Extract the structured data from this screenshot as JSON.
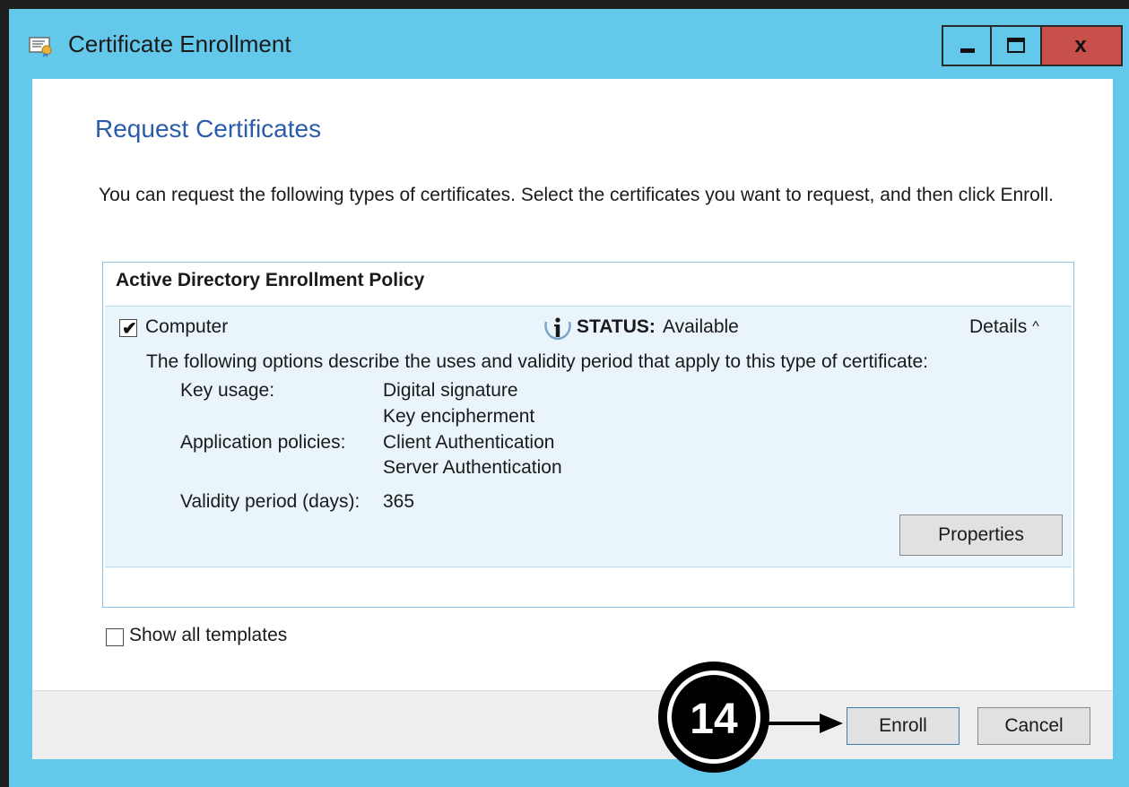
{
  "window": {
    "title": "Certificate Enrollment",
    "controls": {
      "minimize": "minimize",
      "maximize": "maximize",
      "close": "x"
    },
    "colors": {
      "titlebar": "#64c8eb",
      "close_button": "#c7504b",
      "heading": "#2a5cab"
    }
  },
  "page": {
    "heading": "Request Certificates",
    "intro": "You can request the following types of certificates. Select the certificates you want to request, and then click Enroll."
  },
  "policy": {
    "header": "Active Directory Enrollment Policy",
    "item": {
      "name": "Computer",
      "checked": true,
      "status_label": "STATUS:",
      "status_value": "Available",
      "details_label": "Details",
      "description": "The following options describe the uses and validity period that apply to this type of certificate:",
      "properties": {
        "key_usage_label": "Key usage:",
        "key_usage_values": [
          "Digital signature",
          "Key encipherment"
        ],
        "app_policies_label": "Application policies:",
        "app_policies_values": [
          "Client Authentication",
          "Server Authentication"
        ],
        "validity_label": "Validity period (days):",
        "validity_value": "365"
      },
      "properties_button": "Properties"
    }
  },
  "options": {
    "show_all_templates": "Show all templates",
    "show_all_checked": false
  },
  "footer": {
    "enroll": "Enroll",
    "cancel": "Cancel"
  },
  "callout": {
    "step": "14"
  },
  "icons": {
    "app": "certificate-icon",
    "status": "info-icon",
    "details": "chevron-up-icon",
    "callout_arrow": "arrow-right-icon"
  }
}
